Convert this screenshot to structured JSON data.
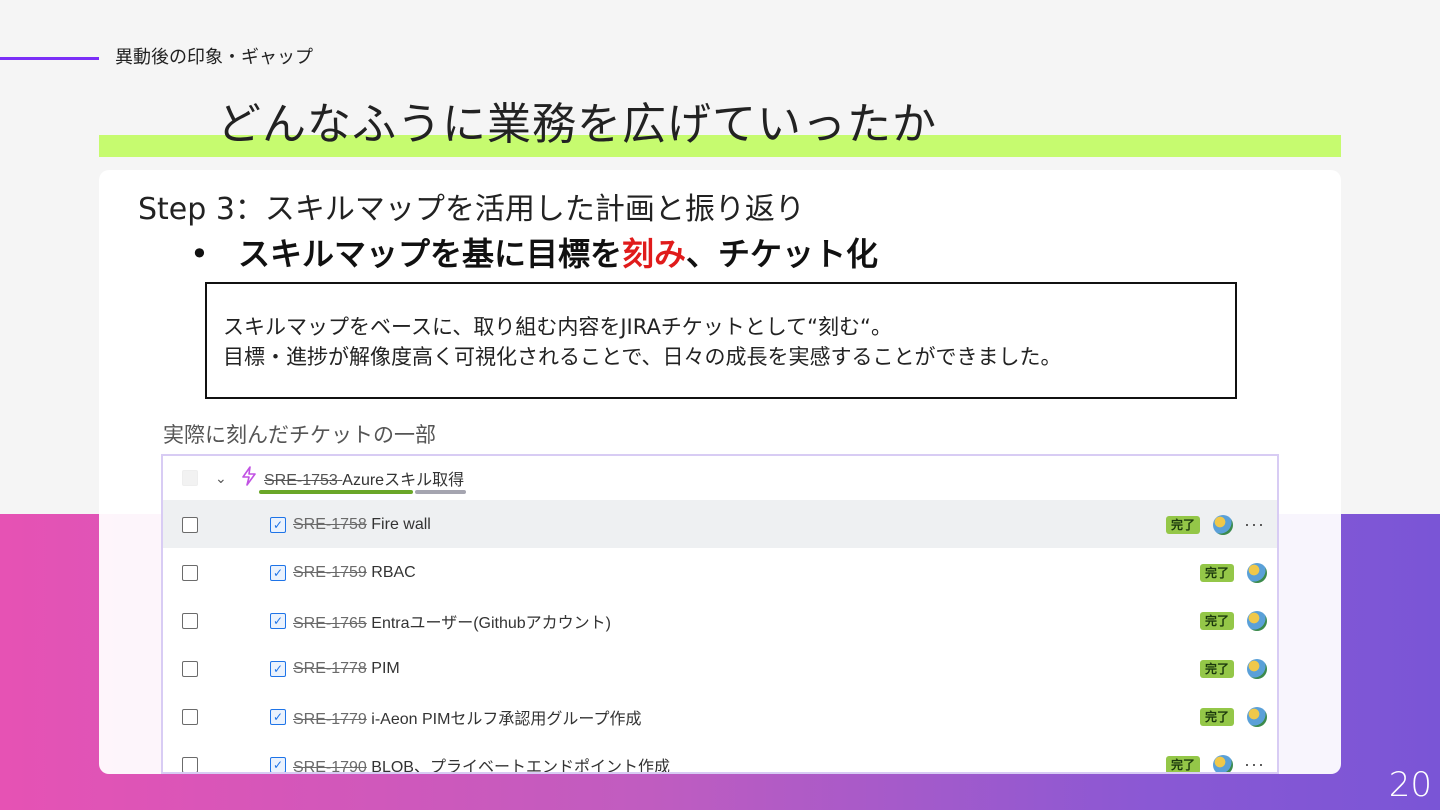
{
  "slide": {
    "section_label": "異動後の印象・ギャップ",
    "title": "どんなふうに業務を広げていったか",
    "step_heading": "Step 3：スキルマップを活用した計画と振り返り",
    "bullet": {
      "marker": "•",
      "text_before": "スキルマップを基に目標を",
      "text_highlight": "刻み",
      "text_after": "、チケット化"
    },
    "note": {
      "line1": "スキルマップをベースに、取り組む内容をJIRAチケットとして“刻む“。",
      "line2": "目標・進捗が解像度高く可視化されることで、日々の成長を実感することができました。"
    },
    "caption": "実際に刻んだチケットの一部",
    "page_number": "20",
    "colors": {
      "accent_line": "#7b2ff7",
      "title_highlight": "#c6fb6f",
      "emphasis_red": "#e01b1b",
      "gradient_start": "#e652b4",
      "gradient_end": "#7a55d6"
    }
  },
  "jira": {
    "parent": {
      "key": "SRE-1753",
      "summary": "Azureスキル取得",
      "icon": "epic-lightning-icon",
      "progress_done_fraction": 0.75
    },
    "children": [
      {
        "key": "SRE-1758",
        "summary": "Fire wall",
        "status": "完了",
        "more": "···"
      },
      {
        "key": "SRE-1759",
        "summary": "RBAC",
        "status": "完了",
        "more": ""
      },
      {
        "key": "SRE-1765",
        "summary": "Entraユーザー(Githubアカウント)",
        "status": "完了",
        "more": ""
      },
      {
        "key": "SRE-1778",
        "summary": "PIM",
        "status": "完了",
        "more": ""
      },
      {
        "key": "SRE-1779",
        "summary": "i-Aeon PIMセルフ承認用グループ作成",
        "status": "完了",
        "more": ""
      },
      {
        "key": "SRE-1790",
        "summary": "BLOB、プライベートエンドポイント作成",
        "status": "完了",
        "more": "···"
      }
    ],
    "task_icon": "checkbox-task-icon",
    "status_color": "#94c748"
  }
}
